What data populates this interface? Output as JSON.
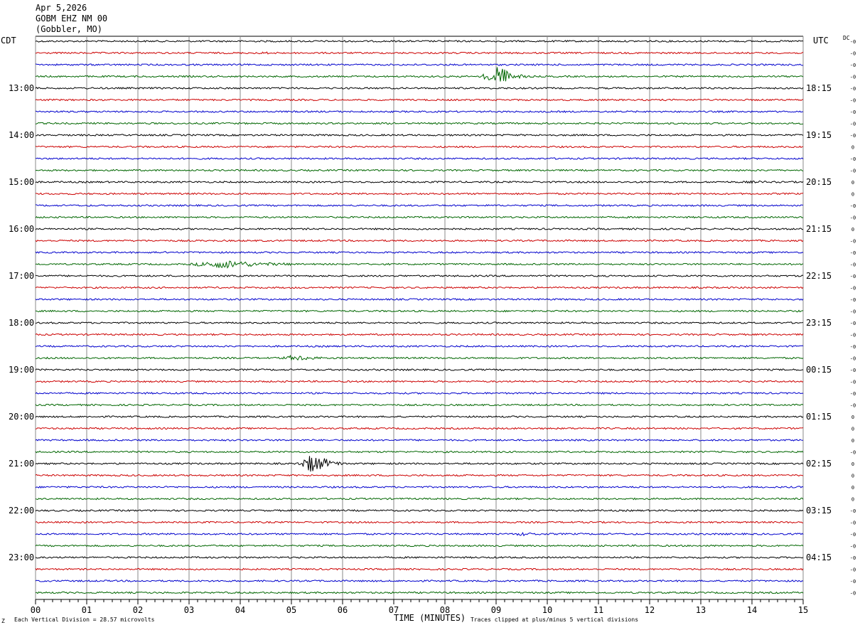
{
  "header": {
    "date": "Apr 5,2026",
    "station": "GOBM EHZ NM 00",
    "location": "(Gobbler, MO)"
  },
  "left_tz": "CDT",
  "right_tz": "UTC",
  "dc_label": "DC",
  "footer": {
    "scale_note": "Each Vertical Division =   28.57 microvolts",
    "xaxis_title": "TIME (MINUTES)",
    "clip_note": "Traces clipped at plus/minus 5 vertical divisions",
    "corner_mark": "Z"
  },
  "colors": {
    "trace_cycle": [
      "#000000",
      "#cc0000",
      "#0000cc",
      "#006600"
    ],
    "grid": "#888888"
  },
  "chart_data": {
    "type": "line",
    "title": "GOBM EHZ NM 00",
    "xlabel": "TIME (MINUTES)",
    "xlim": [
      0,
      15
    ],
    "x_ticks": [
      "00",
      "01",
      "02",
      "03",
      "04",
      "05",
      "06",
      "07",
      "08",
      "09",
      "10",
      "11",
      "12",
      "13",
      "14",
      "15"
    ],
    "trace_count": 48,
    "trace_minutes": 15,
    "left_hour_labels": [
      {
        "trace": 4,
        "label": "13:00"
      },
      {
        "trace": 8,
        "label": "14:00"
      },
      {
        "trace": 12,
        "label": "15:00"
      },
      {
        "trace": 16,
        "label": "16:00"
      },
      {
        "trace": 20,
        "label": "17:00"
      },
      {
        "trace": 24,
        "label": "18:00"
      },
      {
        "trace": 28,
        "label": "19:00"
      },
      {
        "trace": 32,
        "label": "20:00"
      },
      {
        "trace": 36,
        "label": "21:00"
      },
      {
        "trace": 40,
        "label": "22:00"
      },
      {
        "trace": 44,
        "label": "23:00"
      }
    ],
    "right_hour_labels": [
      {
        "trace": 4,
        "label": "18:15"
      },
      {
        "trace": 8,
        "label": "19:15"
      },
      {
        "trace": 12,
        "label": "20:15"
      },
      {
        "trace": 16,
        "label": "21:15"
      },
      {
        "trace": 20,
        "label": "22:15"
      },
      {
        "trace": 24,
        "label": "23:15"
      },
      {
        "trace": 28,
        "label": "00:15"
      },
      {
        "trace": 32,
        "label": "01:15"
      },
      {
        "trace": 36,
        "label": "02:15"
      },
      {
        "trace": 40,
        "label": "03:15"
      },
      {
        "trace": 44,
        "label": "04:15"
      }
    ],
    "dc_offsets": [
      "-0",
      "-0",
      "-0",
      "-0",
      "-0",
      "-0",
      "-0",
      "-0",
      "-0",
      "0",
      "-0",
      "-0",
      "0",
      "0",
      "-0",
      "-0",
      "0",
      "-0",
      "-0",
      "-0",
      "-0",
      "-0",
      "-0",
      "-0",
      "-0",
      "-0",
      "-0",
      "-0",
      "-0",
      "-0",
      "-0",
      "-0",
      "0",
      "0",
      "0",
      "-0",
      "0",
      "0",
      "0",
      "0",
      "-0",
      "-0",
      "-0",
      "-0",
      "-0",
      "-0",
      "-0",
      "-0"
    ],
    "events": [
      {
        "trace": 3,
        "start_min": 8.7,
        "peak_min": 9.05,
        "end_min": 9.6,
        "amp_div": 5.0
      },
      {
        "trace": 19,
        "start_min": 3.0,
        "peak_min": 3.7,
        "end_min": 5.0,
        "amp_div": 2.0
      },
      {
        "trace": 27,
        "start_min": 4.8,
        "peak_min": 5.1,
        "end_min": 5.7,
        "amp_div": 1.2
      },
      {
        "trace": 36,
        "start_min": 5.1,
        "peak_min": 5.45,
        "end_min": 6.0,
        "amp_div": 5.0
      },
      {
        "trace": 42,
        "start_min": 9.3,
        "peak_min": 9.6,
        "end_min": 9.9,
        "amp_div": 0.6
      },
      {
        "trace": 12,
        "start_min": 13.8,
        "peak_min": 14.1,
        "end_min": 14.5,
        "amp_div": 0.25
      },
      {
        "trace": 1,
        "start_min": 4.3,
        "peak_min": 4.5,
        "end_min": 4.9,
        "amp_div": 0.2
      },
      {
        "trace": 18,
        "start_min": 2.4,
        "peak_min": 2.6,
        "end_min": 2.8,
        "amp_div": 0.1
      }
    ]
  }
}
